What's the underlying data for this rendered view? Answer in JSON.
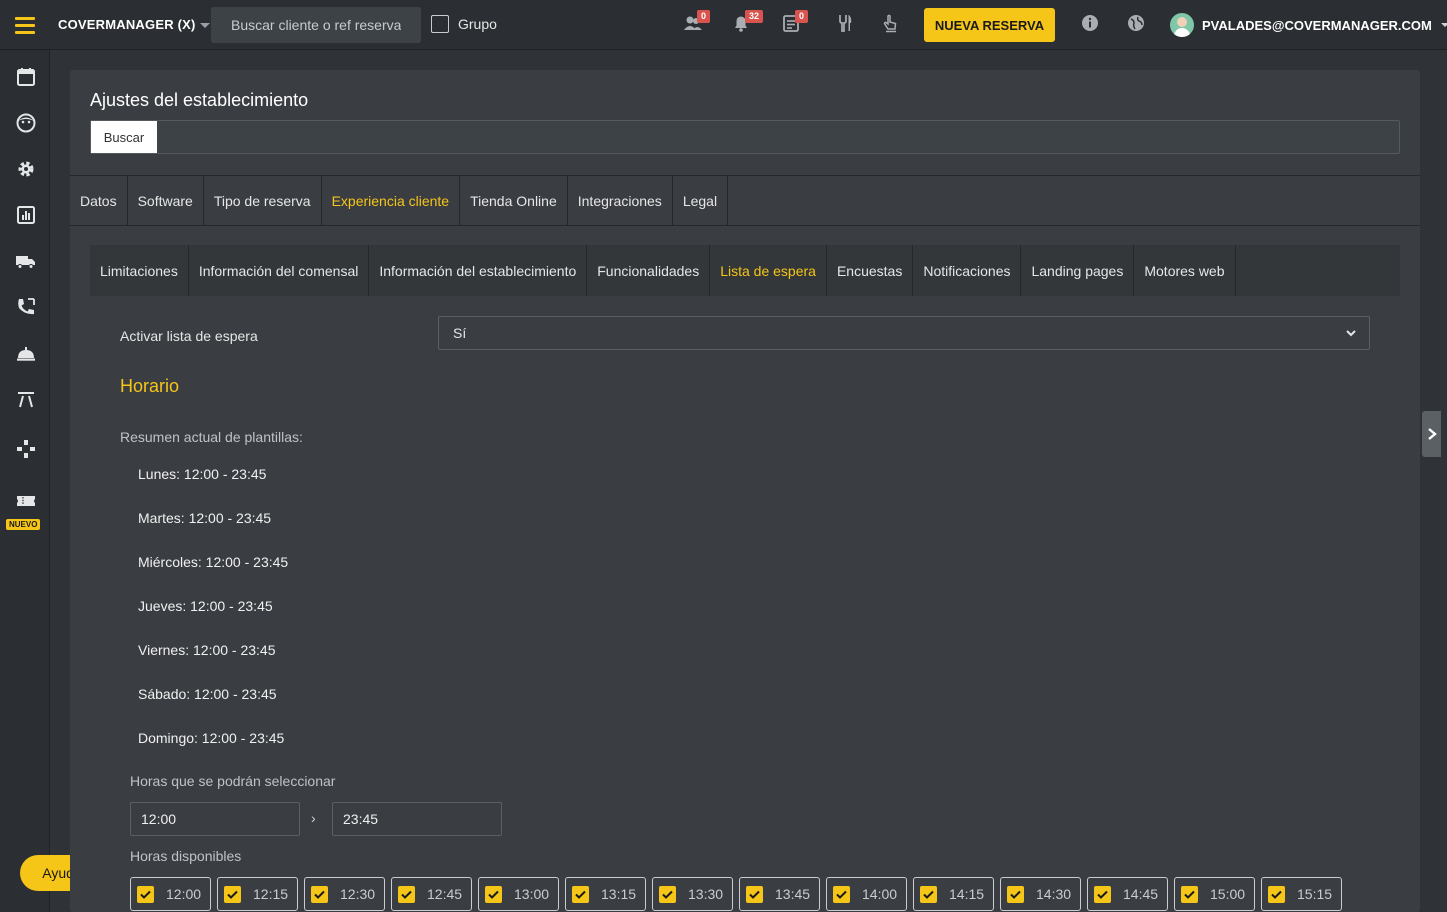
{
  "topbar": {
    "brand": "COVERMANAGER (X)",
    "search_placeholder": "Buscar cliente o ref reserva",
    "grupo_label": "Grupo",
    "badges": {
      "clients": "0",
      "notifications": "32",
      "tasks": "0"
    },
    "new_reservation": "NUEVA RESERVA",
    "user_email": "PVALADES@COVERMANAGER.COM"
  },
  "sidebar": {
    "icons": [
      "calendar-icon",
      "face-icon",
      "gear-icon",
      "chart-icon",
      "truck-icon",
      "phone-icon",
      "service-bell-icon",
      "road-icon",
      "gamepad-icon",
      "ticket-icon"
    ],
    "new_tag": "NUEVO",
    "help_button": "Ayuda"
  },
  "panel": {
    "title": "Ajustes del establecimiento",
    "search_button": "Buscar",
    "tabs": [
      "Datos",
      "Software",
      "Tipo de reserva",
      "Experiencia cliente",
      "Tienda Online",
      "Integraciones",
      "Legal"
    ],
    "active_tab": "Experiencia cliente",
    "subtabs": [
      "Limitaciones",
      "Información del comensal",
      "Información del establecimiento",
      "Funcionalidades",
      "Lista de espera",
      "Encuestas",
      "Notificaciones",
      "Landing pages",
      "Motores web"
    ],
    "active_subtab": "Lista de espera"
  },
  "waitlist": {
    "activate_label": "Activar lista de espera",
    "activate_value": "Sí",
    "schedule_heading": "Horario",
    "summary_label": "Resumen actual de plantillas:",
    "days": [
      "Lunes: 12:00 - 23:45",
      "Martes: 12:00 - 23:45",
      "Miércoles: 12:00 - 23:45",
      "Jueves: 12:00 - 23:45",
      "Viernes: 12:00 - 23:45",
      "Sábado: 12:00 - 23:45",
      "Domingo: 12:00 - 23:45"
    ],
    "selectable_hours_label": "Horas que se podrán seleccionar",
    "from_time": "12:00",
    "separator": "›",
    "to_time": "23:45",
    "available_hours_label": "Horas disponibles",
    "slots": [
      "12:00",
      "12:15",
      "12:30",
      "12:45",
      "13:00",
      "13:15",
      "13:30",
      "13:45",
      "14:00",
      "14:15",
      "14:30",
      "14:45",
      "15:00",
      "15:15"
    ]
  },
  "colors": {
    "accent": "#f5c518",
    "background": "#2f3337",
    "panel": "#3a3e42",
    "badge": "#d9534f"
  }
}
